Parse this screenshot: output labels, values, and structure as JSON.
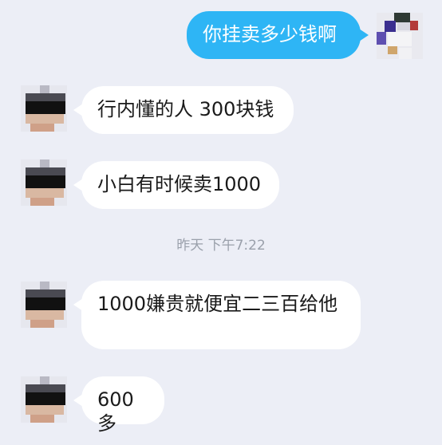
{
  "messages": [
    {
      "side": "right",
      "text": "你挂卖多少钱啊"
    },
    {
      "side": "left",
      "text": "行内懂的人 300块钱"
    },
    {
      "side": "left",
      "text": "小白有时候卖1000"
    },
    {
      "side": "left",
      "text": "1000嫌贵就便宜二三百给他"
    },
    {
      "side": "left",
      "text": "600多"
    }
  ],
  "timestamp": "昨天 下午7:22"
}
